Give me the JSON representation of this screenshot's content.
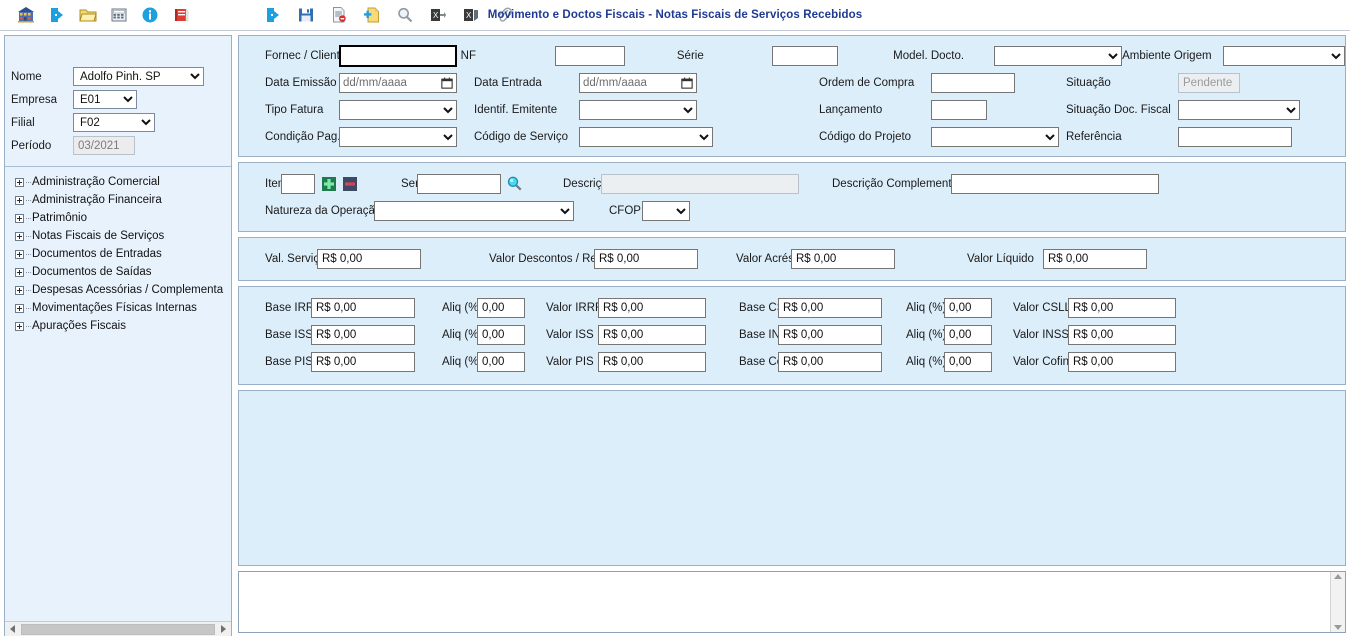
{
  "window": {
    "title": "Movimento e Doctos Fiscais - Notas Fiscais de Serviços Recebidos"
  },
  "toolbar": {
    "left_group": [
      {
        "name": "company-icon",
        "label": "Empresa"
      },
      {
        "name": "exit-door-icon",
        "label": "Sair"
      },
      {
        "name": "open-folder-icon",
        "label": "Abrir"
      },
      {
        "name": "calculator-icon",
        "label": "Calculadora"
      },
      {
        "name": "info-icon",
        "label": "Informações"
      },
      {
        "name": "book-icon",
        "label": "Manual"
      }
    ],
    "right_group": [
      {
        "name": "exit-door-icon",
        "label": "Sair"
      },
      {
        "name": "save-icon",
        "label": "Salvar"
      },
      {
        "name": "delete-document-icon",
        "label": "Excluir"
      },
      {
        "name": "new-document-icon",
        "label": "Novo"
      },
      {
        "name": "search-icon",
        "label": "Pesquisar"
      },
      {
        "name": "excel-export-icon",
        "label": "Exportar Excel"
      },
      {
        "name": "excel-import-icon",
        "label": "Importar Excel"
      },
      {
        "name": "attachment-icon",
        "label": "Anexos"
      }
    ]
  },
  "sidebar": {
    "fields": [
      {
        "label": "Nome",
        "value": "Adolfo Pinh. SP",
        "type": "select"
      },
      {
        "label": "Empresa",
        "value": "E01",
        "type": "select"
      },
      {
        "label": "Filial",
        "value": "F02",
        "type": "select"
      },
      {
        "label": "Período",
        "value": "03/2021",
        "type": "readonly"
      }
    ],
    "tree_items": [
      "Administração Comercial",
      "Administração Financeira",
      "Patrimônio",
      "Notas Fiscais de Serviços",
      "Documentos de Entradas",
      "Documentos de Saídas",
      "Despesas Acessórias / Complementa",
      "Movimentações Físicas Internas",
      "Apurações Fiscais"
    ]
  },
  "form": {
    "section_header": {
      "rows": [
        {
          "col1": {
            "label": "Fornec / Cliente",
            "value": "",
            "type": "text-focused"
          },
          "col2": {
            "label": "NF",
            "value": "",
            "type": "text"
          },
          "col3": {
            "label": "Série",
            "value": "",
            "type": "text"
          },
          "col4": {
            "label": "Model. Docto.",
            "value": "",
            "type": "select"
          },
          "col5": {
            "label": "Ambiente Origem",
            "value": "",
            "type": "select"
          }
        },
        {
          "col1": {
            "label": "Data Emissão",
            "value": "dd/mm/aaaa",
            "type": "date"
          },
          "col2": {
            "label": "Data Entrada",
            "value": "dd/mm/aaaa",
            "type": "date"
          },
          "col4": {
            "label": "Ordem de Compra",
            "value": "",
            "type": "text"
          },
          "col5": {
            "label": "Situação",
            "value": "Pendente",
            "type": "readonly"
          }
        },
        {
          "col1": {
            "label": "Tipo Fatura",
            "value": "",
            "type": "select"
          },
          "col2": {
            "label": "Identif. Emitente",
            "value": "",
            "type": "select"
          },
          "col4": {
            "label": "Lançamento",
            "value": "",
            "type": "text"
          },
          "col5": {
            "label": "Situação Doc. Fiscal",
            "value": "",
            "type": "select"
          }
        },
        {
          "col1": {
            "label": "Condição Pag.",
            "value": "",
            "type": "select"
          },
          "col2": {
            "label": "Código de Serviço",
            "value": "",
            "type": "select"
          },
          "col4": {
            "label": "Código do Projeto",
            "value": "",
            "type": "select"
          },
          "col5": {
            "label": "Referência",
            "value": "",
            "type": "text"
          }
        }
      ]
    },
    "section_item": {
      "item_label": "Item",
      "item_value": "",
      "add_button": "add-item-button",
      "remove_button": "remove-item-button",
      "servico_label": "Serviço",
      "servico_value": "",
      "descricao_label": "Descrição",
      "descricao_value": "",
      "descricao_complementar_label": "Descrição Complementar",
      "descricao_complementar_value": "",
      "natureza_label": "Natureza da Operação",
      "natureza_value": "",
      "cfop_label": "CFOP",
      "cfop_value": ""
    },
    "section_values": [
      {
        "label": "Val. Serviço",
        "value": "R$ 0,00"
      },
      {
        "label": "Valor Descontos / Retenção",
        "value": "R$ 0,00"
      },
      {
        "label": "Valor Acrés.",
        "value": "R$ 0,00"
      },
      {
        "label": "Valor Líquido",
        "value": "R$ 0,00"
      }
    ],
    "section_taxes": {
      "aliq_label": "Aliq (%)",
      "rows": [
        {
          "left_base_label": "Base IRRF",
          "left_base_value": "R$ 0,00",
          "left_aliq_value": "0,00",
          "left_val_label": "Valor IRRF",
          "left_val_value": "R$ 0,00",
          "right_base_label": "Base CSLL",
          "right_base_value": "R$ 0,00",
          "right_aliq_value": "0,00",
          "right_val_label": "Valor CSLL",
          "right_val_value": "R$ 0,00"
        },
        {
          "left_base_label": "Base ISS",
          "left_base_value": "R$ 0,00",
          "left_aliq_value": "0,00",
          "left_val_label": "Valor ISS",
          "left_val_value": "R$ 0,00",
          "right_base_label": "Base INSS",
          "right_base_value": "R$ 0,00",
          "right_aliq_value": "0,00",
          "right_val_label": "Valor INSS",
          "right_val_value": "R$ 0,00"
        },
        {
          "left_base_label": "Base PIS",
          "left_base_value": "R$ 0,00",
          "left_aliq_value": "0,00",
          "left_val_label": "Valor PIS",
          "left_val_value": "R$ 0,00",
          "right_base_label": "Base Cofins",
          "right_base_value": "R$ 0,00",
          "right_aliq_value": "0,00",
          "right_val_label": "Valor Cofins",
          "right_val_value": "R$ 0,00"
        }
      ]
    },
    "notes": {
      "value": ""
    }
  },
  "statusbar": {
    "text": ""
  },
  "colors": {
    "title": "#1f3a93",
    "panel_bg": "#ddeefb",
    "sidebar_bg": "#e8f2fc",
    "border": "#9bb0c7"
  }
}
